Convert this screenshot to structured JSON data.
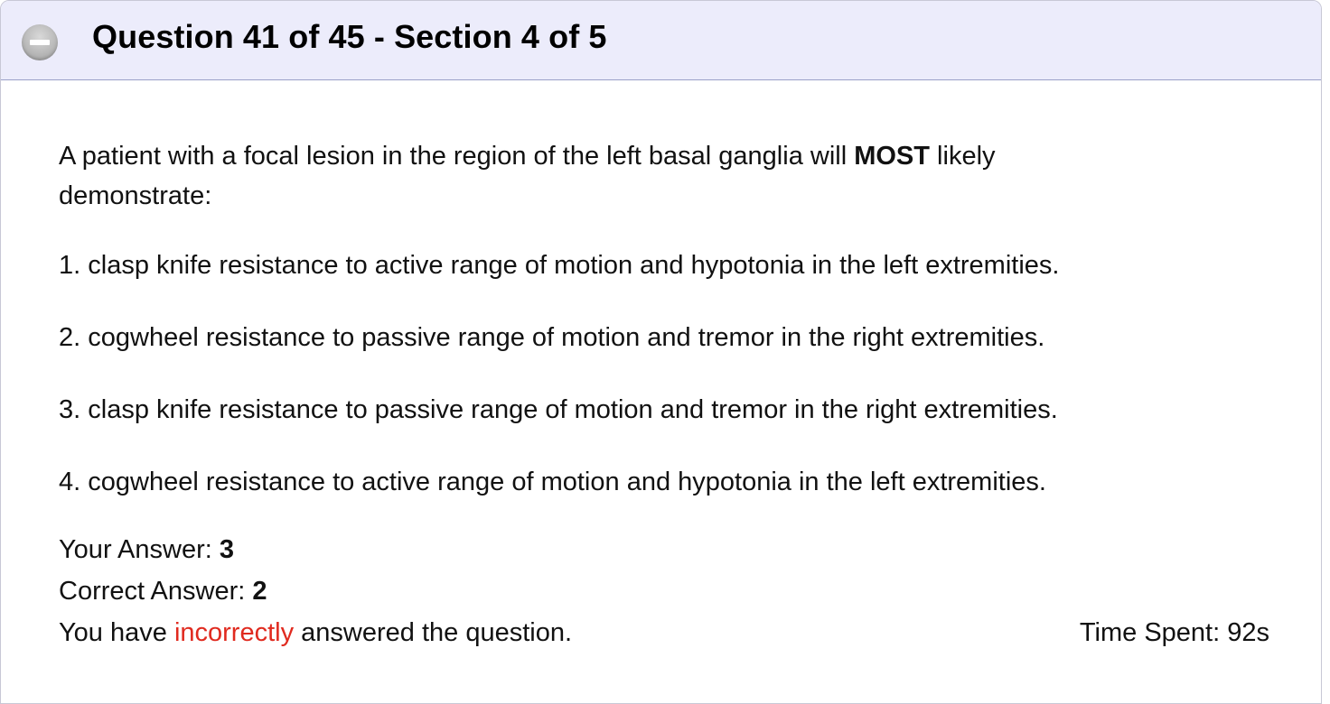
{
  "header": {
    "title": "Question 41 of 45 - Section 4 of 5"
  },
  "question": {
    "stem_before": "A patient with a focal lesion in the region of the left basal ganglia will ",
    "stem_emphasis": "MOST",
    "stem_after": " likely demonstrate:",
    "options": [
      {
        "number": "1.",
        "text": "clasp knife resistance to active range of motion and hypotonia in the left extremities."
      },
      {
        "number": "2.",
        "text": "cogwheel resistance to passive range of motion and tremor in the right extremities."
      },
      {
        "number": "3.",
        "text": "clasp knife resistance to passive range of motion and tremor in the right extremities."
      },
      {
        "number": "4.",
        "text": "cogwheel resistance to active range of motion and hypotonia in the left extremities."
      }
    ]
  },
  "results": {
    "your_answer_label": "Your Answer: ",
    "your_answer_value": "3",
    "correct_answer_label": "Correct Answer: ",
    "correct_answer_value": "2",
    "status_before": "You have ",
    "status_word": "incorrectly",
    "status_after": " answered the question.",
    "status_color": "#e02a1f",
    "time_spent": "Time Spent: 92s"
  }
}
